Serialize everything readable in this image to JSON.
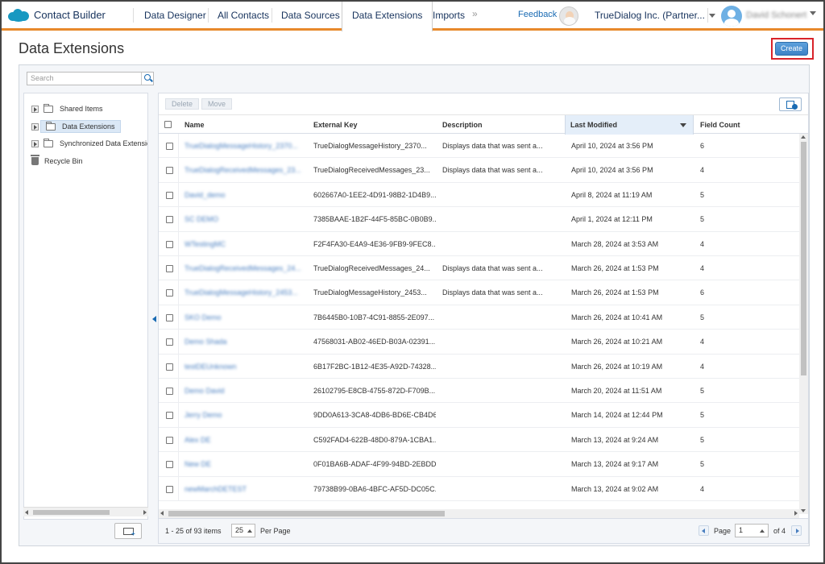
{
  "app": {
    "title": "Contact Builder"
  },
  "nav": {
    "tabs": [
      {
        "label": "Data Designer"
      },
      {
        "label": "All Contacts"
      },
      {
        "label": "Data Sources"
      },
      {
        "label": "Data Extensions"
      },
      {
        "label": "Imports"
      }
    ],
    "more": "»",
    "feedback": "Feedback",
    "org": "TrueDialog Inc. (Partner...",
    "user": "David Schonert"
  },
  "page": {
    "title": "Data Extensions",
    "create_label": "Create"
  },
  "search": {
    "placeholder": "Search"
  },
  "tree": {
    "items": [
      {
        "label": "Shared Items"
      },
      {
        "label": "Data Extensions"
      },
      {
        "label": "Synchronized Data Extensions"
      },
      {
        "label": "Recycle Bin"
      }
    ]
  },
  "toolbar": {
    "delete_label": "Delete",
    "move_label": "Move"
  },
  "table": {
    "columns": [
      "Name",
      "External Key",
      "Description",
      "Last Modified",
      "Field Count"
    ],
    "rows": [
      {
        "name": "TrueDialogMessageHistory_2370...",
        "key": "TrueDialogMessageHistory_2370...",
        "desc": "Displays data that was sent a...",
        "modified": "April 10, 2024 at 3:56 PM",
        "count": "6"
      },
      {
        "name": "TrueDialogReceivedMessages_23...",
        "key": "TrueDialogReceivedMessages_23...",
        "desc": "Displays data that was sent a...",
        "modified": "April 10, 2024 at 3:56 PM",
        "count": "4"
      },
      {
        "name": "David_demo",
        "key": "602667A0-1EE2-4D91-98B2-1D4B9...",
        "desc": "",
        "modified": "April 8, 2024 at 11:19 AM",
        "count": "5"
      },
      {
        "name": "SC DEMO",
        "key": "7385BAAE-1B2F-44F5-85BC-0B0B9...",
        "desc": "",
        "modified": "April 1, 2024 at 12:11 PM",
        "count": "5"
      },
      {
        "name": "WTestingMC",
        "key": "F2F4FA30-E4A9-4E36-9FB9-9FEC8...",
        "desc": "",
        "modified": "March 28, 2024 at 3:53 AM",
        "count": "4"
      },
      {
        "name": "TrueDialogReceivedMessages_24...",
        "key": "TrueDialogReceivedMessages_24...",
        "desc": "Displays data that was sent a...",
        "modified": "March 26, 2024 at 1:53 PM",
        "count": "4"
      },
      {
        "name": "TrueDialogMessageHistory_2453...",
        "key": "TrueDialogMessageHistory_2453...",
        "desc": "Displays data that was sent a...",
        "modified": "March 26, 2024 at 1:53 PM",
        "count": "6"
      },
      {
        "name": "SKO Demo",
        "key": "7B6445B0-10B7-4C91-8855-2E097...",
        "desc": "",
        "modified": "March 26, 2024 at 10:41 AM",
        "count": "5"
      },
      {
        "name": "Demo Shada",
        "key": "47568031-AB02-46ED-B03A-02391...",
        "desc": "",
        "modified": "March 26, 2024 at 10:21 AM",
        "count": "4"
      },
      {
        "name": "testDEUnknown",
        "key": "6B17F2BC-1B12-4E35-A92D-74328...",
        "desc": "",
        "modified": "March 26, 2024 at 10:19 AM",
        "count": "4"
      },
      {
        "name": "Demo David",
        "key": "26102795-E8CB-4755-872D-F709B...",
        "desc": "",
        "modified": "March 20, 2024 at 11:51 AM",
        "count": "5"
      },
      {
        "name": "Jerry Demo",
        "key": "9DD0A613-3CA8-4DB6-BD6E-CB4D6...",
        "desc": "",
        "modified": "March 14, 2024 at 12:44 PM",
        "count": "5"
      },
      {
        "name": "Alex DE",
        "key": "C592FAD4-622B-48D0-879A-1CBA1...",
        "desc": "",
        "modified": "March 13, 2024 at 9:24 AM",
        "count": "5"
      },
      {
        "name": "New DE",
        "key": "0F01BA6B-ADAF-4F99-94BD-2EBDD...",
        "desc": "",
        "modified": "March 13, 2024 at 9:17 AM",
        "count": "5"
      },
      {
        "name": "newMarchDETEST",
        "key": "79738B99-0BA6-4BFC-AF5D-DC05C...",
        "desc": "",
        "modified": "March 13, 2024 at 9:02 AM",
        "count": "4"
      }
    ]
  },
  "footer": {
    "items_count": "1 - 25 of 93 items",
    "per_page_value": "25",
    "per_page_label": "Per Page",
    "page_label": "Page",
    "page_value": "1",
    "page_of": "of 4"
  },
  "colors": {
    "accent_orange": "#e8892b",
    "brand_blue": "#1798c1",
    "link_blue": "#1a6bb3",
    "create_highlight": "#d8232a"
  }
}
